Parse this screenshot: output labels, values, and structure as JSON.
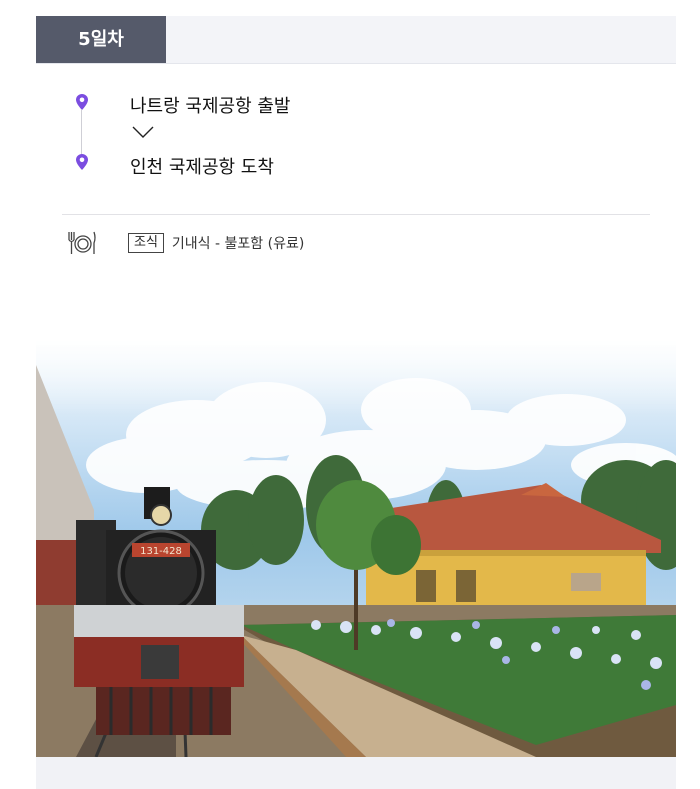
{
  "day": {
    "label": "5일차"
  },
  "route": {
    "departure": "나트랑 국제공항 출발",
    "arrival": "인천 국제공항 도착"
  },
  "meal": {
    "tag": "조식",
    "description": "기내식 - 불포함 (유료)"
  },
  "photo": {
    "alt": "Dalat railway station steam locomotive",
    "locomotive_plate": "131-428"
  },
  "colors": {
    "badge_bg": "#555a6a",
    "header_bg": "#f3f4f8",
    "pin": "#7b4de0"
  }
}
